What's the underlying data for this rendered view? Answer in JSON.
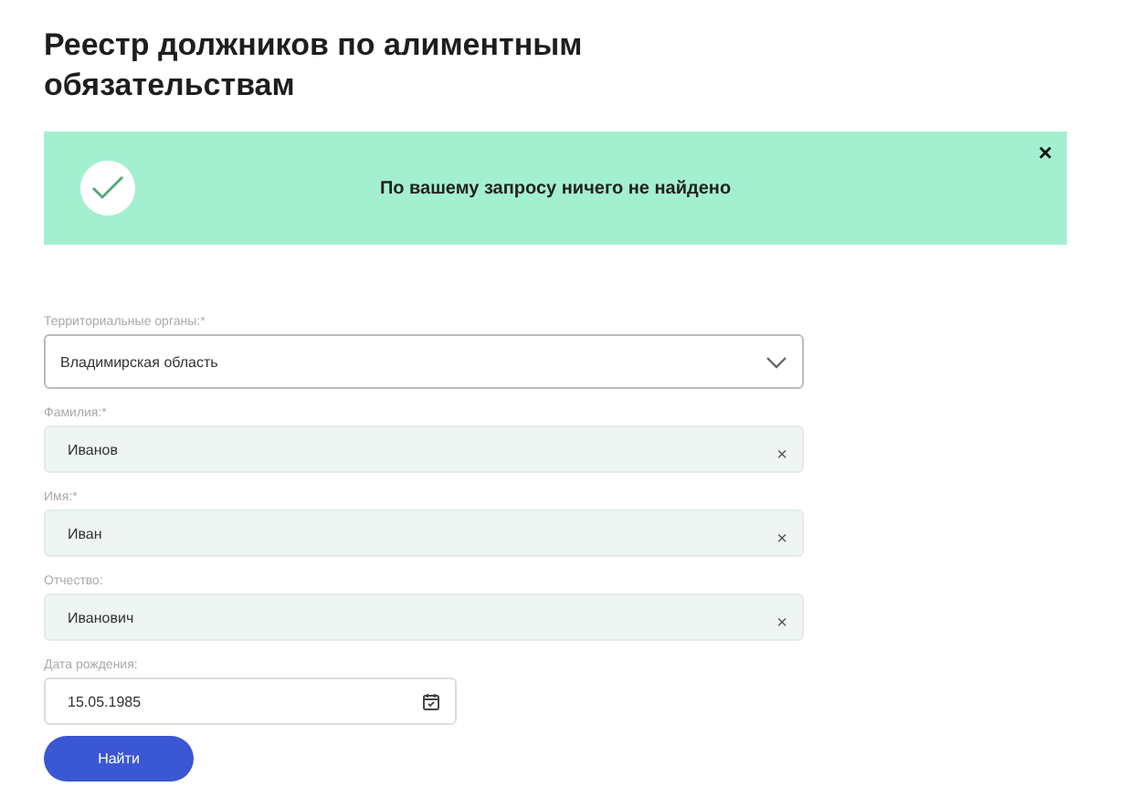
{
  "title": "Реестр должников по алиментным обязательствам",
  "notice": {
    "message": "По вашему запросу ничего не найдено",
    "close": "×"
  },
  "fields": [
    {
      "kind": "select",
      "label": "Территориальные органы:*",
      "value": "Владимирская область"
    },
    {
      "kind": "text",
      "label": "Фамилия:*",
      "value": "Иванов",
      "clear": "×"
    },
    {
      "kind": "text",
      "label": "Имя:*",
      "value": "Иван",
      "clear": "×"
    },
    {
      "kind": "text",
      "label": "Отчество:",
      "value": "Иванович",
      "clear": "×"
    },
    {
      "kind": "date",
      "label": "Дата рождения:",
      "value": "15.05.1985"
    }
  ],
  "submit": "Найти"
}
